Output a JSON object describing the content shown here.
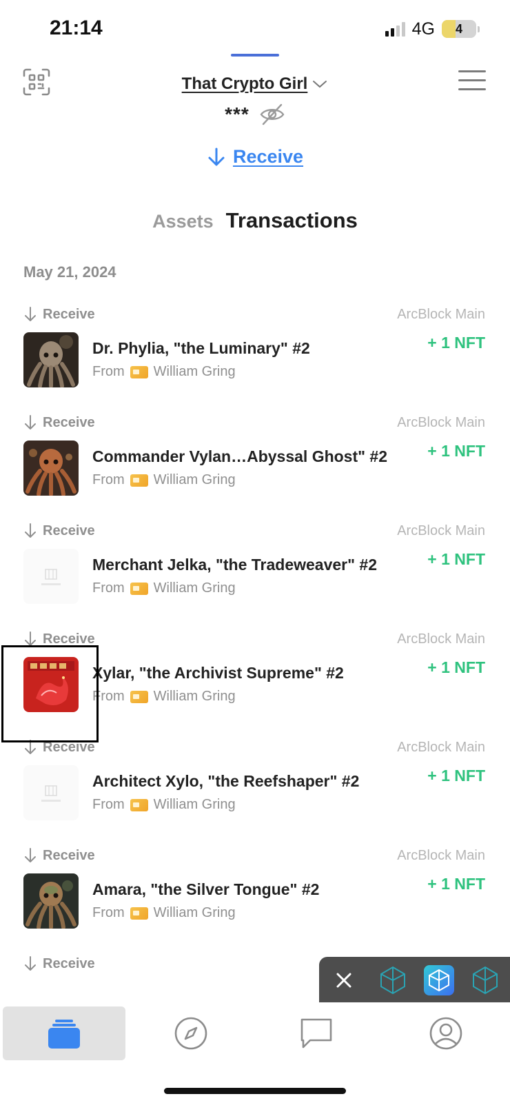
{
  "status_bar": {
    "time": "21:14",
    "network": "4G",
    "battery_level": "4",
    "battery_fraction": 0.4
  },
  "header": {
    "account_name": "That Crypto Girl",
    "balance_masked": "***",
    "receive_label": "Receive"
  },
  "tabs": [
    {
      "label": "Assets",
      "active": false
    },
    {
      "label": "Transactions",
      "active": true
    }
  ],
  "transactions": {
    "date_header": "May 21, 2024",
    "items": [
      {
        "type": "Receive",
        "chain": "ArcBlock Main",
        "title": "Dr. Phylia, \"the Luminary\" #2",
        "from_label": "From",
        "from_name": "William Gring",
        "amount": "+ 1 NFT",
        "thumb": "octopus-gold-icon"
      },
      {
        "type": "Receive",
        "chain": "ArcBlock Main",
        "title": "Commander Vylan…Abyssal Ghost\" #2",
        "from_label": "From",
        "from_name": "William Gring",
        "amount": "+ 1 NFT",
        "thumb": "octopus-copper-icon"
      },
      {
        "type": "Receive",
        "chain": "ArcBlock Main",
        "title": "Merchant Jelka, \"the Tradeweaver\" #2",
        "from_label": "From",
        "from_name": "William Gring",
        "amount": "+ 1 NFT",
        "thumb": "placeholder-icon"
      },
      {
        "type": "Receive",
        "chain": "ArcBlock Main",
        "title": "Xylar, \"the Archivist Supreme\" #2",
        "from_label": "From",
        "from_name": "William Gring",
        "amount": "+ 1 NFT",
        "thumb": "red-dragon-icon"
      },
      {
        "type": "Receive",
        "chain": "ArcBlock Main",
        "title": "Architect Xylo, \"the Reefshaper\" #2",
        "from_label": "From",
        "from_name": "William Gring",
        "amount": "+ 1 NFT",
        "thumb": "placeholder-icon"
      },
      {
        "type": "Receive",
        "chain": "ArcBlock Main",
        "title": "Amara, \"the Silver Tongue\" #2",
        "from_label": "From",
        "from_name": "William Gring",
        "amount": "+ 1 NFT",
        "thumb": "octopus-green-icon"
      },
      {
        "type": "Receive"
      }
    ]
  },
  "bottom_tabs": [
    {
      "name": "wallet",
      "icon": "wallet-icon",
      "active": true
    },
    {
      "name": "explore",
      "icon": "compass-icon",
      "active": false
    },
    {
      "name": "messages",
      "icon": "chat-icon",
      "active": false
    },
    {
      "name": "profile",
      "icon": "profile-icon",
      "active": false
    }
  ],
  "colors": {
    "accent": "#3a86f0",
    "amount": "#2ec27e",
    "muted": "#8f8f8f"
  }
}
